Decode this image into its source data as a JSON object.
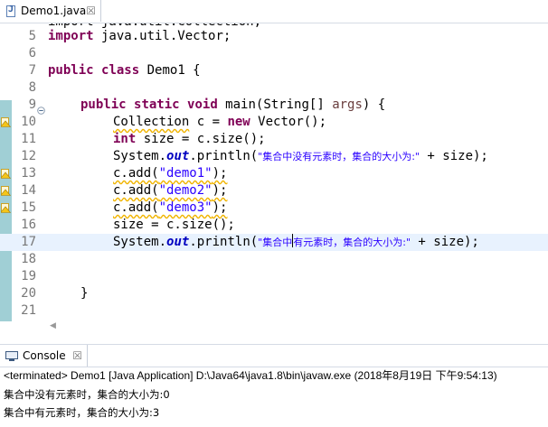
{
  "editor": {
    "tab_label": "Demo1.java",
    "tab_close": "☒",
    "lines": [
      {
        "num": "5"
      },
      {
        "num": "6"
      },
      {
        "num": "7"
      },
      {
        "num": "8"
      },
      {
        "num": "9"
      },
      {
        "num": "10"
      },
      {
        "num": "11"
      },
      {
        "num": "12"
      },
      {
        "num": "13"
      },
      {
        "num": "14"
      },
      {
        "num": "15"
      },
      {
        "num": "16"
      },
      {
        "num": "17"
      },
      {
        "num": "18"
      },
      {
        "num": "19"
      },
      {
        "num": "20"
      },
      {
        "num": "21"
      }
    ],
    "tokens": {
      "import_kw": "import",
      "import_path": " java.util.Vector;",
      "public_kw": "public",
      "class_kw": "class",
      "class_name": " Demo1 {",
      "static_kw": "static",
      "void_kw": "void",
      "main_sig_a": " main(String[] ",
      "args": "args",
      "main_sig_b": ") {",
      "collection_type": "Collection",
      "c_decl": " c = ",
      "new_kw": "new",
      "vector_ctor": " Vector();",
      "int_kw": "int",
      "size_decl": " size = c.size();",
      "system": "System.",
      "out": "out",
      "println_open": ".println(",
      "str_empty": "\"集合中没有元素时，集合的大小为:\"",
      "plus_size": " + size);",
      "add_call": "c.add(",
      "demo1": "\"demo1\"",
      "demo2": "\"demo2\"",
      "demo3": "\"demo3\"",
      "close_paren": ");",
      "size_assign": "size = c.size();",
      "str_has_a": "\"集合中",
      "str_has_b": "有元素时，集合的大小为:\"",
      "close_brace": "}"
    }
  },
  "console": {
    "tab_label": "Console",
    "tab_close": "☒",
    "status": "<terminated> Demo1 [Java Application] D:\\Java64\\java1.8\\bin\\javaw.exe (2018年8月19日 下午9:54:13)",
    "output": [
      "集合中没有元素时，集合的大小为:0",
      "集合中有元素时，集合的大小为:3"
    ]
  },
  "colors": {
    "keyword": "#7f0055",
    "string": "#2a00ff",
    "field": "#0000c0",
    "current_line": "#e8f2fe",
    "change_bar": "#8fc7ce"
  }
}
